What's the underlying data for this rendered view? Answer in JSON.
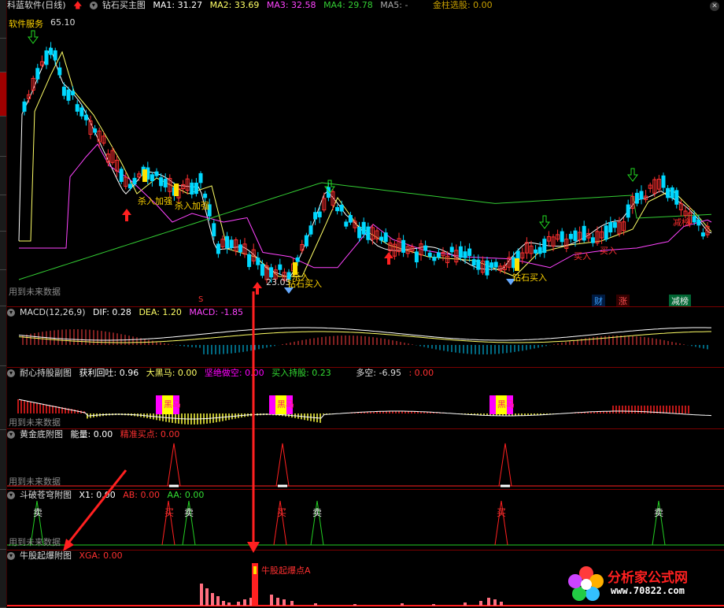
{
  "colors": {
    "bg": "#000000",
    "up": "#ff3030",
    "down": "#00d8ff",
    "ma1": "#ffffff",
    "ma2": "#ffff66",
    "ma3": "#ff44ff",
    "ma4": "#33cc33",
    "grid": "#7a0000",
    "accent": "#ffd400",
    "magenta": "#ff00ff",
    "green": "#00e000"
  },
  "main": {
    "title": "科蓝软件(日线)",
    "indicator": "钻石买主图",
    "ma1": "MA1: 31.27",
    "ma2": "MA2: 33.69",
    "ma3": "MA3: 32.58",
    "ma4": "MA4: 29.78",
    "ma5": "MA5: -",
    "stock_select": "金柱选股: 0.00",
    "service": "软件服务",
    "high_price": "65.10",
    "low_price": "23.05",
    "labels": [
      "杀入加强",
      "杀入加强",
      "钻石买入",
      "钻石买入",
      "买入",
      "买入",
      "杀入",
      "减榜"
    ],
    "label_buy": "买入",
    "label_kill": "杀入加强",
    "future": "用到未来数据",
    "badges": [
      "财",
      "涨",
      "减榜"
    ],
    "s_mark": "S"
  },
  "macd": {
    "name": "MACD(12,26,9)",
    "dif": "DIF: 0.28",
    "dea": "DEA: 1.20",
    "macd": "MACD: -1.85"
  },
  "hold": {
    "name": "耐心持股副图",
    "v1": "获利回吐: 0.96",
    "v2": "大黑马: 0.00",
    "v3": "坚绝做空: 0.00",
    "v4": "买入持股: 0.23",
    "v5": "多空: -6.95",
    "v6": ": 0.00",
    "black_horse": "黑马",
    "future": "用到未来数据"
  },
  "gold": {
    "name": "黄金底附图",
    "energy": "能量: 0.00",
    "precise": "精准买点: 0.00",
    "future": "用到未来数据"
  },
  "douPo": {
    "name": "斗破苍穹附图",
    "x1": "X1: 0.00",
    "ab": "AB: 0.00",
    "aa": "AA: 0.00",
    "sell": "卖",
    "buy": "买",
    "future": "用到未来数据"
  },
  "bull": {
    "name": "牛股起爆附图",
    "xga": "XGA: 0.00",
    "explode": "牛股起爆点A"
  },
  "watermark": {
    "text": "分析家公式网",
    "url": "www.70822.com"
  }
}
